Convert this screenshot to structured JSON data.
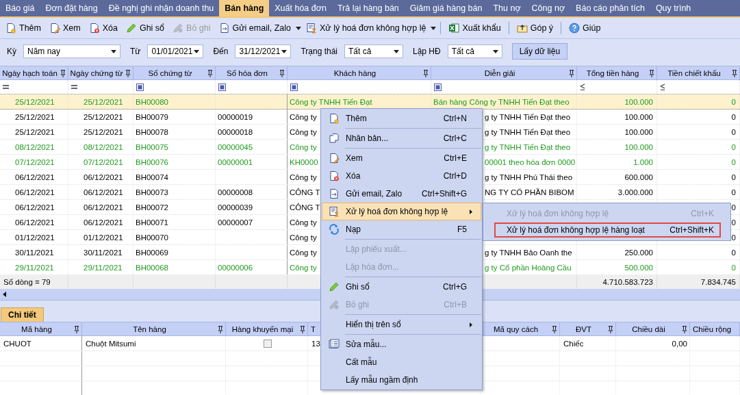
{
  "tabs": [
    {
      "label": "Báo giá",
      "selected": false
    },
    {
      "label": "Đơn đặt hàng",
      "selected": false
    },
    {
      "label": "Đề nghị ghi nhận doanh thu",
      "selected": false
    },
    {
      "label": "Bán hàng",
      "selected": true
    },
    {
      "label": "Xuất hóa đơn",
      "selected": false
    },
    {
      "label": "Trả lại hàng bán",
      "selected": false
    },
    {
      "label": "Giảm giá hàng bán",
      "selected": false
    },
    {
      "label": "Thu nợ",
      "selected": false
    },
    {
      "label": "Công nợ",
      "selected": false
    },
    {
      "label": "Báo cáo phân tích",
      "selected": false
    },
    {
      "label": "Quy trình",
      "selected": false
    }
  ],
  "toolbar": [
    {
      "kind": "button",
      "label": "Thêm",
      "disabled": false
    },
    {
      "kind": "button",
      "label": "Xem",
      "disabled": false
    },
    {
      "kind": "button",
      "label": "Xóa",
      "disabled": false
    },
    {
      "kind": "button",
      "label": "Ghi sổ",
      "disabled": false
    },
    {
      "kind": "button",
      "label": "Bỏ ghi",
      "disabled": true
    },
    {
      "kind": "button",
      "label": "Gửi email, Zalo",
      "disabled": false,
      "dropdown": true
    },
    {
      "kind": "button",
      "label": "Xử lý hoá đơn không hợp lệ",
      "disabled": false,
      "dropdown": true
    },
    {
      "kind": "separator"
    },
    {
      "kind": "button",
      "label": "Xuất khẩu",
      "disabled": false
    },
    {
      "kind": "separator"
    },
    {
      "kind": "button",
      "label": "Góp ý",
      "disabled": false
    },
    {
      "kind": "separator"
    },
    {
      "kind": "button",
      "label": "Giúp",
      "disabled": false
    }
  ],
  "filters": [
    {
      "label": "Kỳ",
      "value": "Năm nay"
    },
    {
      "label": "Từ",
      "value": "01/01/2021"
    },
    {
      "label": "Đến",
      "value": "31/12/2021"
    },
    {
      "label": "Trạng thái",
      "value": "Tất cả"
    },
    {
      "label": "Lập HĐ",
      "value": "Tất cả"
    }
  ],
  "fetch_button": "Lấy dữ liệu",
  "grid": {
    "columns": [
      {
        "label": "Ngày hạch toán",
        "kind": "date",
        "filter": {
          "kind": "equals"
        }
      },
      {
        "label": "Ngày chứng từ",
        "kind": "date",
        "filter": {
          "kind": "equals"
        }
      },
      {
        "label": "Số chứng từ",
        "kind": "text",
        "filter": {
          "kind": "contains"
        }
      },
      {
        "label": "Số hóa đơn",
        "kind": "text",
        "filter": {
          "kind": "contains"
        }
      },
      {
        "label": "Khách hàng",
        "kind": "text",
        "filter": {
          "kind": "contains"
        }
      },
      {
        "label": "Diễn giải",
        "kind": "text",
        "filter": {
          "kind": "contains"
        }
      },
      {
        "label": "Tổng tiền hàng",
        "kind": "number",
        "filter": {
          "kind": "less_equal"
        }
      },
      {
        "label": "Tiền chiết khấu",
        "kind": "number",
        "filter": {
          "kind": "less_equal"
        }
      }
    ],
    "rows": [
      {
        "selected": true,
        "color": "#1f9a1f",
        "cells": [
          "25/12/2021",
          "25/12/2021",
          "BH00080",
          null,
          "Công ty TNHH Tiến Đạt",
          "Bán hàng Công ty TNHH Tiến Đạt theo",
          "100.000",
          "0"
        ]
      },
      {
        "selected": false,
        "color": "#000000",
        "cells": [
          "25/12/2021",
          "25/12/2021",
          "BH00079",
          "00000019",
          "Công ty",
          "g ty TNHH Tiến Đạt theo",
          "100.000",
          "0"
        ]
      },
      {
        "selected": false,
        "color": "#000000",
        "cells": [
          "25/12/2021",
          "25/12/2021",
          "BH00078",
          "00000018",
          "Công ty",
          "g ty TNHH Tiến Đạt theo",
          "100.000",
          "0"
        ]
      },
      {
        "selected": false,
        "color": "#1f9a1f",
        "cells": [
          "08/12/2021",
          "08/12/2021",
          "BH00075",
          "00000045",
          "Công ty",
          "g ty TNHH Tiến Đạt theo",
          "100.000",
          "0"
        ]
      },
      {
        "selected": false,
        "color": "#1f9a1f",
        "cells": [
          "07/12/2021",
          "07/12/2021",
          "BH00076",
          "00000001",
          "KH0000",
          "00001 theo hóa đơn 0000",
          "1.000",
          "0"
        ]
      },
      {
        "selected": false,
        "color": "#000000",
        "cells": [
          "06/12/2021",
          "06/12/2021",
          "BH00074",
          null,
          "Công ty",
          "g ty TNHH Phú Thái theo",
          "600.000",
          "0"
        ]
      },
      {
        "selected": false,
        "color": "#000000",
        "cells": [
          "06/12/2021",
          "06/12/2021",
          "BH00073",
          "00000008",
          "CÔNG T",
          "NG TY CỔ PHẦN BIBOM",
          "3.000.000",
          "0"
        ]
      },
      {
        "selected": false,
        "color": "#000000",
        "cells": [
          "06/12/2021",
          "06/12/2021",
          "BH00072",
          "00000039",
          "CÔNG T",
          null,
          null,
          "0"
        ]
      },
      {
        "selected": false,
        "color": "#000000",
        "cells": [
          "06/12/2021",
          "06/12/2021",
          "BH00071",
          "00000007",
          "Công ty",
          null,
          null,
          "0"
        ]
      },
      {
        "selected": false,
        "color": "#000000",
        "cells": [
          "01/12/2021",
          "01/12/2021",
          "BH00070",
          null,
          "Công ty",
          null,
          null,
          "0"
        ]
      },
      {
        "selected": false,
        "color": "#000000",
        "cells": [
          "30/11/2021",
          "30/11/2021",
          "BH00069",
          null,
          "Công ty",
          "g ty TNHH Bảo Oanh the",
          "250.000",
          "0"
        ]
      },
      {
        "selected": false,
        "color": "#1f9a1f",
        "cells": [
          "29/11/2021",
          "29/11/2021",
          "BH00068",
          "00000006",
          "Công ty",
          "g ty Cổ phần Hoàng Cầu",
          "500.000",
          "0"
        ]
      }
    ],
    "summary": {
      "count": "Số dòng = 79",
      "total_goods": "4.710.583.723",
      "total_discount": "7.834.745"
    }
  },
  "detail": {
    "tab": {
      "label": "Chi tiết",
      "selected": true
    },
    "columns": [
      {
        "label": "Mã hàng"
      },
      {
        "label": "Tên hàng"
      },
      {
        "label": "Hàng khuyến mại"
      },
      {
        "label": "T"
      },
      {
        "label": "Mã quy cách"
      },
      {
        "label": "ĐVT"
      },
      {
        "label": "Chiều dài"
      },
      {
        "label": "Chiều rộng"
      }
    ],
    "rows": [
      {
        "cells": [
          "CHUOT",
          "Chuột Mitsumi",
          null,
          "13",
          null,
          "Chiếc",
          "0,00",
          null
        ],
        "promotion": false
      }
    ]
  },
  "context_menu": {
    "items": [
      {
        "kind": "item",
        "label": "Thêm",
        "shortcut": "Ctrl+N",
        "disabled": false,
        "selected": false
      },
      {
        "kind": "separator"
      },
      {
        "kind": "item",
        "label": "Nhân bản...",
        "shortcut": "Ctrl+C",
        "disabled": false,
        "selected": false
      },
      {
        "kind": "separator"
      },
      {
        "kind": "item",
        "label": "Xem",
        "shortcut": "Ctrl+E",
        "disabled": false,
        "selected": false
      },
      {
        "kind": "item",
        "label": "Xóa",
        "shortcut": "Ctrl+D",
        "disabled": false,
        "selected": false
      },
      {
        "kind": "item",
        "label": "Gửi email, Zalo",
        "shortcut": "Ctrl+Shift+G",
        "disabled": false,
        "selected": false
      },
      {
        "kind": "item",
        "label": "Xử lý hoá đơn không hợp lệ",
        "disabled": false,
        "selected": true,
        "submenu": true
      },
      {
        "kind": "item",
        "label": "Nạp",
        "shortcut": "F5",
        "disabled": false,
        "selected": false
      },
      {
        "kind": "separator"
      },
      {
        "kind": "item",
        "label": "Lập phiếu xuất...",
        "disabled": true,
        "selected": false
      },
      {
        "kind": "item",
        "label": "Lập hóa đơn...",
        "disabled": true,
        "selected": false
      },
      {
        "kind": "separator"
      },
      {
        "kind": "item",
        "label": "Ghi sổ",
        "shortcut": "Ctrl+G",
        "disabled": false,
        "selected": false
      },
      {
        "kind": "item",
        "label": "Bỏ ghi",
        "shortcut": "Ctrl+B",
        "disabled": true,
        "selected": false
      },
      {
        "kind": "separator"
      },
      {
        "kind": "item",
        "label": "Hiển thị trên sổ",
        "disabled": false,
        "selected": false,
        "submenu": true
      },
      {
        "kind": "separator"
      },
      {
        "kind": "item",
        "label": "Sửa mẫu...",
        "disabled": false,
        "selected": false
      },
      {
        "kind": "item",
        "label": "Cất mẫu",
        "disabled": false,
        "selected": false
      },
      {
        "kind": "item",
        "label": "Lấy mẫu ngầm định",
        "disabled": false,
        "selected": false
      }
    ],
    "submenu": [
      {
        "label": "Xử lý hoá đơn không hợp lệ",
        "shortcut": "Ctrl+K",
        "disabled": true,
        "selected": false
      },
      {
        "label": "Xử lý hoá đơn không hợp lệ hàng loạt",
        "shortcut": "Ctrl+Shift+K",
        "disabled": false,
        "selected": true
      }
    ]
  }
}
